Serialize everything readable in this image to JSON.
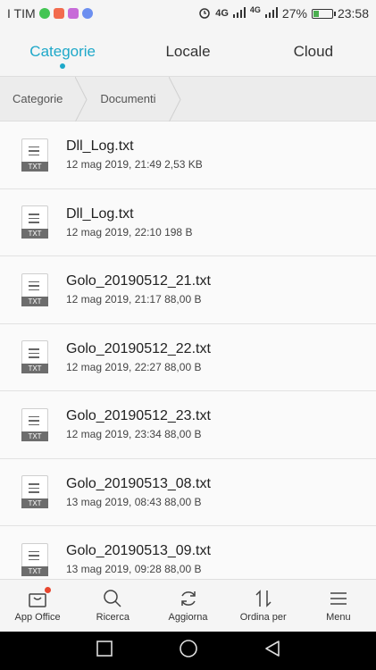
{
  "status_bar": {
    "carrier": "I TIM",
    "network": "4G",
    "network2": "4G",
    "battery": "27%",
    "battery_level": 0.27,
    "time": "23:58"
  },
  "tabs": [
    {
      "label": "Categorie",
      "active": true
    },
    {
      "label": "Locale",
      "active": false
    },
    {
      "label": "Cloud",
      "active": false
    }
  ],
  "breadcrumb": [
    "Categorie",
    "Documenti"
  ],
  "file_type_tag": "TXT",
  "files": [
    {
      "name": "Dll_Log.txt",
      "meta": "12 mag 2019, 21:49 2,53 KB"
    },
    {
      "name": "Dll_Log.txt",
      "meta": "12 mag 2019, 22:10 198 B"
    },
    {
      "name": "Golo_20190512_21.txt",
      "meta": "12 mag 2019, 21:17 88,00 B"
    },
    {
      "name": "Golo_20190512_22.txt",
      "meta": "12 mag 2019, 22:27 88,00 B"
    },
    {
      "name": "Golo_20190512_23.txt",
      "meta": "12 mag 2019, 23:34 88,00 B"
    },
    {
      "name": "Golo_20190513_08.txt",
      "meta": "13 mag 2019, 08:43 88,00 B"
    },
    {
      "name": "Golo_20190513_09.txt",
      "meta": "13 mag 2019, 09:28 88,00 B"
    }
  ],
  "toolbar": [
    {
      "label": "App Office",
      "icon": "bag-icon"
    },
    {
      "label": "Ricerca",
      "icon": "search-icon"
    },
    {
      "label": "Aggiorna",
      "icon": "refresh-icon"
    },
    {
      "label": "Ordina per",
      "icon": "sort-icon"
    },
    {
      "label": "Menu",
      "icon": "menu-icon"
    }
  ],
  "colors": {
    "accent": "#1ea8c9",
    "badge": "#e8462f"
  }
}
